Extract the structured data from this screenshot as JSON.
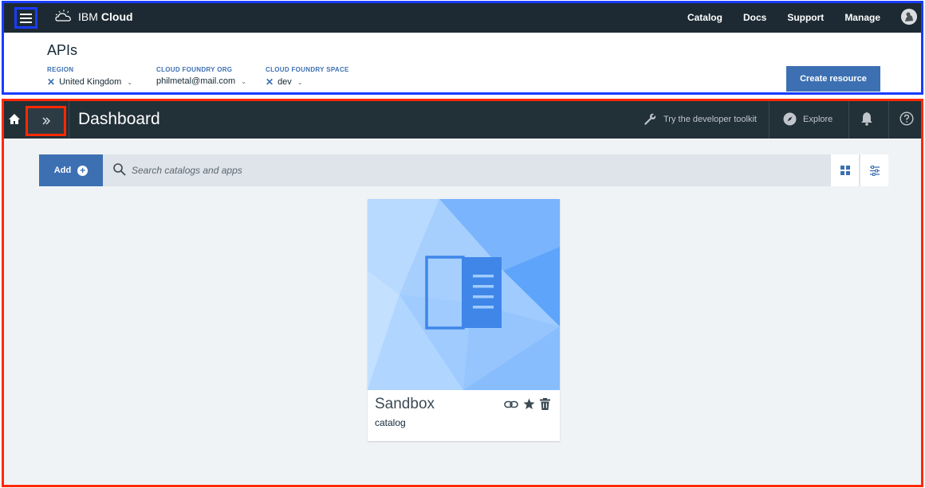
{
  "topbar": {
    "brand_prefix": "IBM",
    "brand_name": "Cloud",
    "nav": [
      "Catalog",
      "Docs",
      "Support",
      "Manage"
    ]
  },
  "context": {
    "title": "APIs",
    "region": {
      "label": "REGION",
      "value": "United Kingdom"
    },
    "org": {
      "label": "CLOUD FOUNDRY ORG",
      "value": "philmetal@mail.com"
    },
    "space": {
      "label": "CLOUD FOUNDRY SPACE",
      "value": "dev"
    },
    "create_button": "Create resource"
  },
  "dashboard": {
    "title": "Dashboard",
    "toolkit_label": "Try the developer toolkit",
    "explore_label": "Explore",
    "add_label": "Add",
    "search_placeholder": "Search catalogs and apps"
  },
  "card": {
    "title": "Sandbox",
    "subtitle": "catalog"
  },
  "colors": {
    "header_bg": "#1d2a33",
    "accent": "#3d70b2",
    "blue_outline": "#1a3cff",
    "red_outline": "#ff2a00"
  }
}
